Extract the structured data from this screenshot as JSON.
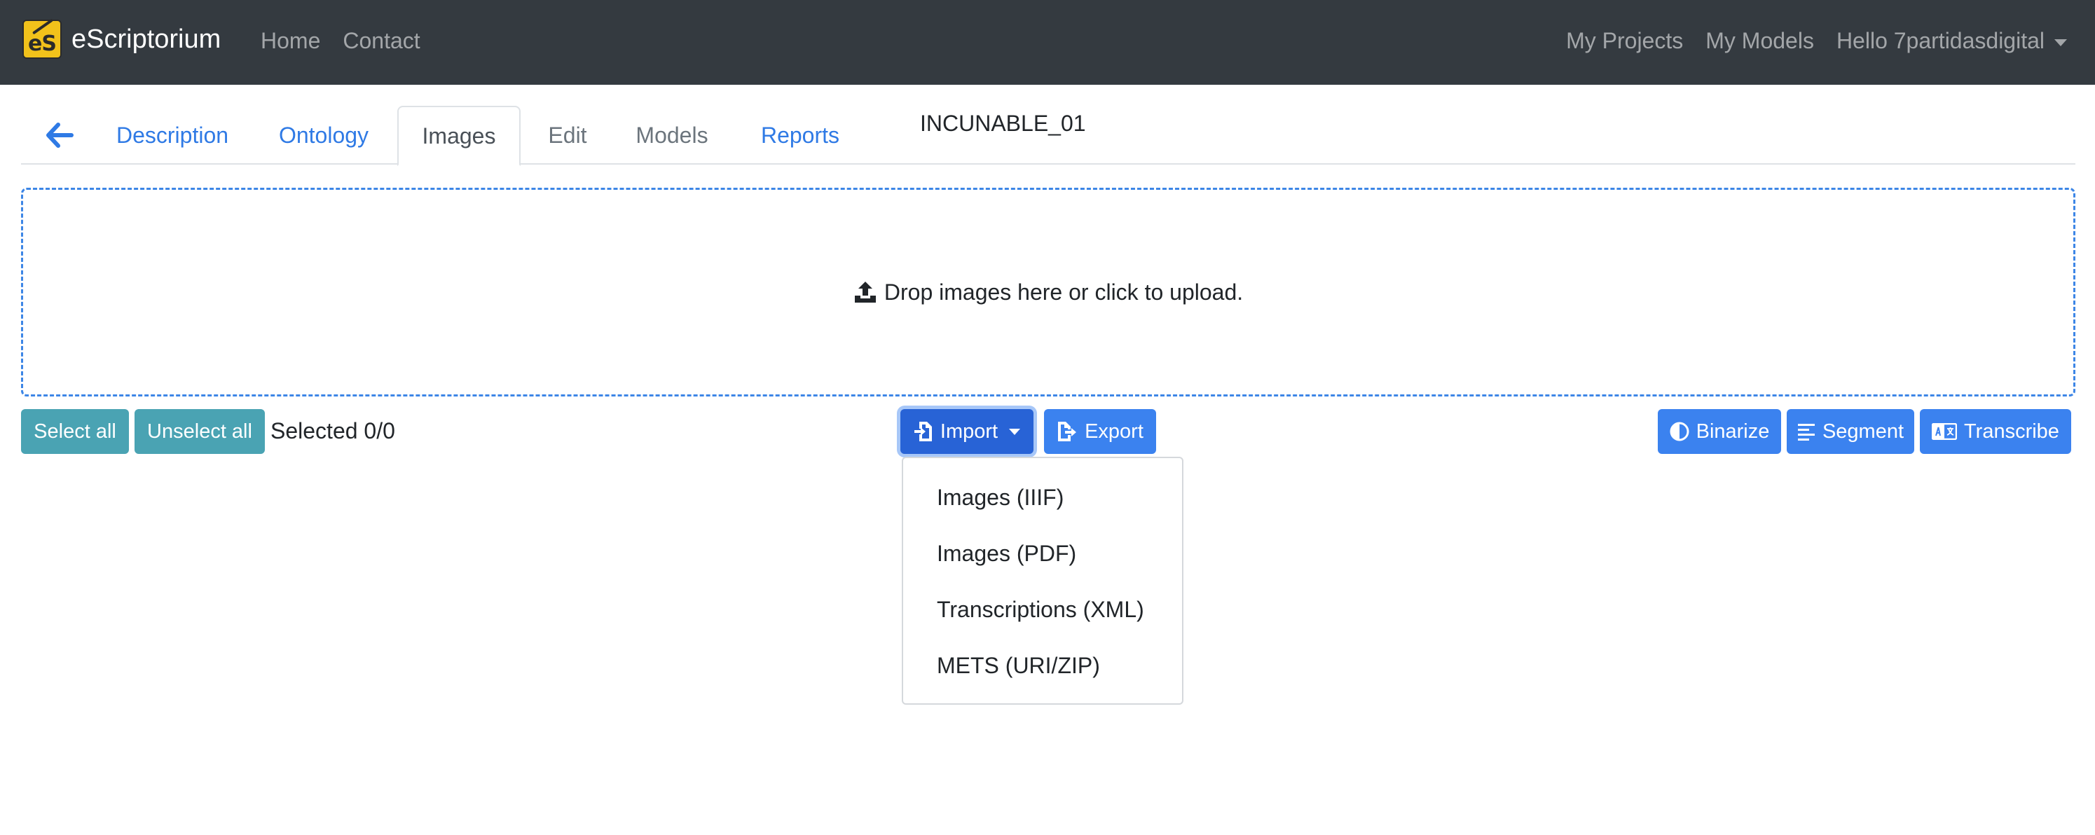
{
  "navbar": {
    "brand_text": "eScriptorium",
    "brand_logo_text": "eS",
    "left_links": [
      "Home",
      "Contact"
    ],
    "projects_label": "My Projects",
    "models_label": "My Models",
    "user_label": "Hello 7partidasdigital"
  },
  "tabs": {
    "description": "Description",
    "ontology": "Ontology",
    "images": "Images",
    "edit": "Edit",
    "models": "Models",
    "reports": "Reports",
    "active": "Images"
  },
  "document": {
    "title": "INCUNABLE_01"
  },
  "dropzone": {
    "text": "Drop images here or click to upload."
  },
  "toolbar": {
    "select_all": "Select all",
    "unselect_all": "Unselect all",
    "selected_count": "Selected 0/0",
    "import_label": "Import",
    "export_label": "Export",
    "binarize_label": "Binarize",
    "segment_label": "Segment",
    "transcribe_label": "Transcribe"
  },
  "import_menu": {
    "items": [
      "Images (IIIF)",
      "Images (PDF)",
      "Transcriptions (XML)",
      "METS (URI/ZIP)"
    ]
  },
  "icons": {
    "back": "arrow-left-icon",
    "upload": "upload-icon",
    "import": "file-import-icon",
    "export": "file-export-icon",
    "binarize": "adjust-icon",
    "segment": "align-left-icon",
    "transcribe": "language-icon"
  },
  "colors": {
    "navbar_bg": "#343a40",
    "link_blue": "#2f7ae5",
    "teal": "#4aa3b3",
    "primary": "#3b82ef",
    "brand_yellow": "#f2c21b"
  }
}
